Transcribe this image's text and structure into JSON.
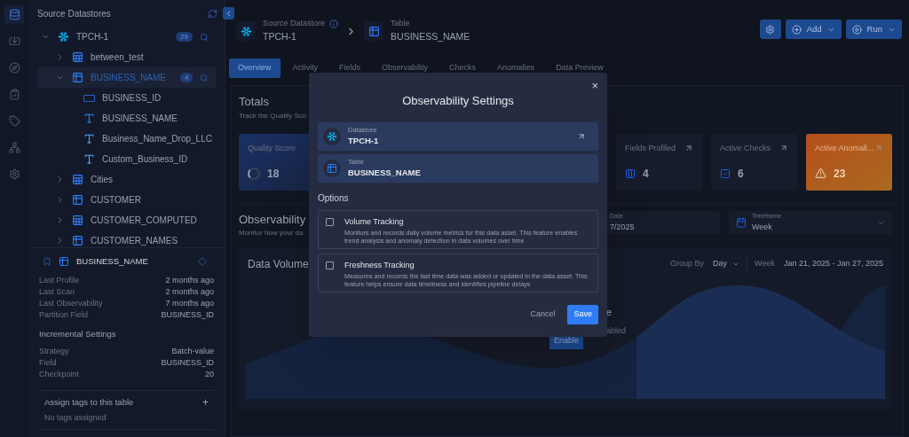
{
  "rail": {
    "items": [
      {
        "kind": "database",
        "selected": true
      },
      {
        "kind": "import",
        "selected": false
      },
      {
        "kind": "compass",
        "selected": false
      },
      {
        "kind": "clipboard",
        "selected": false
      },
      {
        "kind": "tag",
        "selected": false
      },
      {
        "kind": "hierarchy",
        "selected": false
      },
      {
        "kind": "settings",
        "selected": false
      }
    ]
  },
  "sidebar": {
    "title": "Source Datastores",
    "tree": [
      {
        "label": "TPCH-1",
        "kind": "datastore",
        "badge": "29",
        "expanded": true,
        "selected": false,
        "children": [
          {
            "label": "between_test",
            "kind": "view",
            "expanded": false,
            "selected": false
          },
          {
            "label": "BUSINESS_NAME",
            "kind": "table",
            "badge": "4",
            "expanded": true,
            "selected": true,
            "children": [
              {
                "label": "BUSINESS_ID",
                "kind": "number"
              },
              {
                "label": "BUSINESS_NAME",
                "kind": "text"
              },
              {
                "label": "Business_Name_Drop_LLC",
                "kind": "computed"
              },
              {
                "label": "Custom_Business_ID",
                "kind": "computed"
              }
            ]
          },
          {
            "label": "Cities",
            "kind": "view",
            "expanded": false,
            "selected": false
          },
          {
            "label": "CUSTOMER",
            "kind": "table",
            "expanded": false,
            "selected": false
          },
          {
            "label": "CUSTOMER_COMPUTED",
            "kind": "view",
            "expanded": false,
            "selected": false
          },
          {
            "label": "CUSTOMER_NAMES",
            "kind": "table",
            "expanded": false,
            "selected": false
          }
        ]
      }
    ],
    "details": {
      "title": "BUSINESS_NAME",
      "rows": [
        {
          "label": "Last Profile",
          "value": "2 months ago"
        },
        {
          "label": "Last Scan",
          "value": "2 months ago"
        },
        {
          "label": "Last Observability",
          "value": "7 months ago"
        },
        {
          "label": "Partition Field",
          "value": "BUSINESS_ID"
        }
      ],
      "incremental_title": "Incremental Settings",
      "incremental": [
        {
          "label": "Strategy",
          "value": "Batch-value"
        },
        {
          "label": "Field",
          "value": "BUSINESS_ID"
        },
        {
          "label": "Checkpoint",
          "value": "20"
        }
      ],
      "tags_title": "Assign tags to this table",
      "tags_add": "+",
      "tags_empty": "No tags assigned"
    }
  },
  "header": {
    "crumbs": [
      {
        "kind": "datastore",
        "label": "Source Datastore",
        "value": "TPCH-1",
        "info": true
      },
      {
        "kind": "table",
        "label": "Table",
        "value": "BUSINESS_NAME",
        "info": false
      }
    ],
    "buttons": [
      {
        "kind": "settings"
      },
      {
        "kind": "add",
        "label": "Add"
      },
      {
        "kind": "run",
        "label": "Run"
      }
    ]
  },
  "tabs": [
    {
      "label": "Overview",
      "selected": true
    },
    {
      "label": "Activity",
      "selected": false
    },
    {
      "label": "Fields",
      "selected": false
    },
    {
      "label": "Observability",
      "selected": false
    },
    {
      "label": "Checks",
      "selected": false
    },
    {
      "label": "Anomalies",
      "selected": false
    },
    {
      "label": "Data Preview",
      "selected": false
    }
  ],
  "totals": {
    "title": "Totals",
    "subtitle": "Track the Quality Sco",
    "cards": [
      {
        "kind": "score",
        "label": "Quality Score",
        "value": "18"
      },
      {
        "kind": "fields",
        "label": "Fields Profiled",
        "value": "4"
      },
      {
        "kind": "checks",
        "label": "Active Checks",
        "value": "6"
      },
      {
        "kind": "anomalies",
        "label": "Active Anomali...",
        "value": "23"
      }
    ]
  },
  "observability": {
    "title": "Observability",
    "subtitle": "Monitor how your da",
    "date": {
      "label": "Date",
      "value": "7/2025"
    },
    "timeframe": {
      "label": "Timeframe",
      "value": "Week"
    },
    "volume": {
      "title": "Data Volume",
      "group_by_label": "Group By",
      "group_by": "Day",
      "range_label": "Week",
      "range": "Jan 21, 2025 - Jan 27, 2025",
      "notice_1": "e",
      "notice_2": "abled",
      "enable": "Enable"
    }
  },
  "dialog": {
    "title": "Observability Settings",
    "close": "×",
    "assets": [
      {
        "kind": "datastore",
        "label": "Datastore",
        "value": "TPCH-1"
      },
      {
        "kind": "table",
        "label": "Table",
        "value": "BUSINESS_NAME"
      }
    ],
    "options_title": "Options",
    "options": [
      {
        "title": "Volume Tracking",
        "description": "Monitors and records daily volume metrics for this data asset. This feature enables trend analysis and anomaly detection in data volumes over time",
        "checked": false
      },
      {
        "title": "Freshness Tracking",
        "description": "Measures and records the last time data was added or updated in the data asset. This feature helps ensure data timeliness and identifies pipeline delays",
        "checked": false
      }
    ],
    "cancel": "Cancel",
    "save": "Save"
  }
}
